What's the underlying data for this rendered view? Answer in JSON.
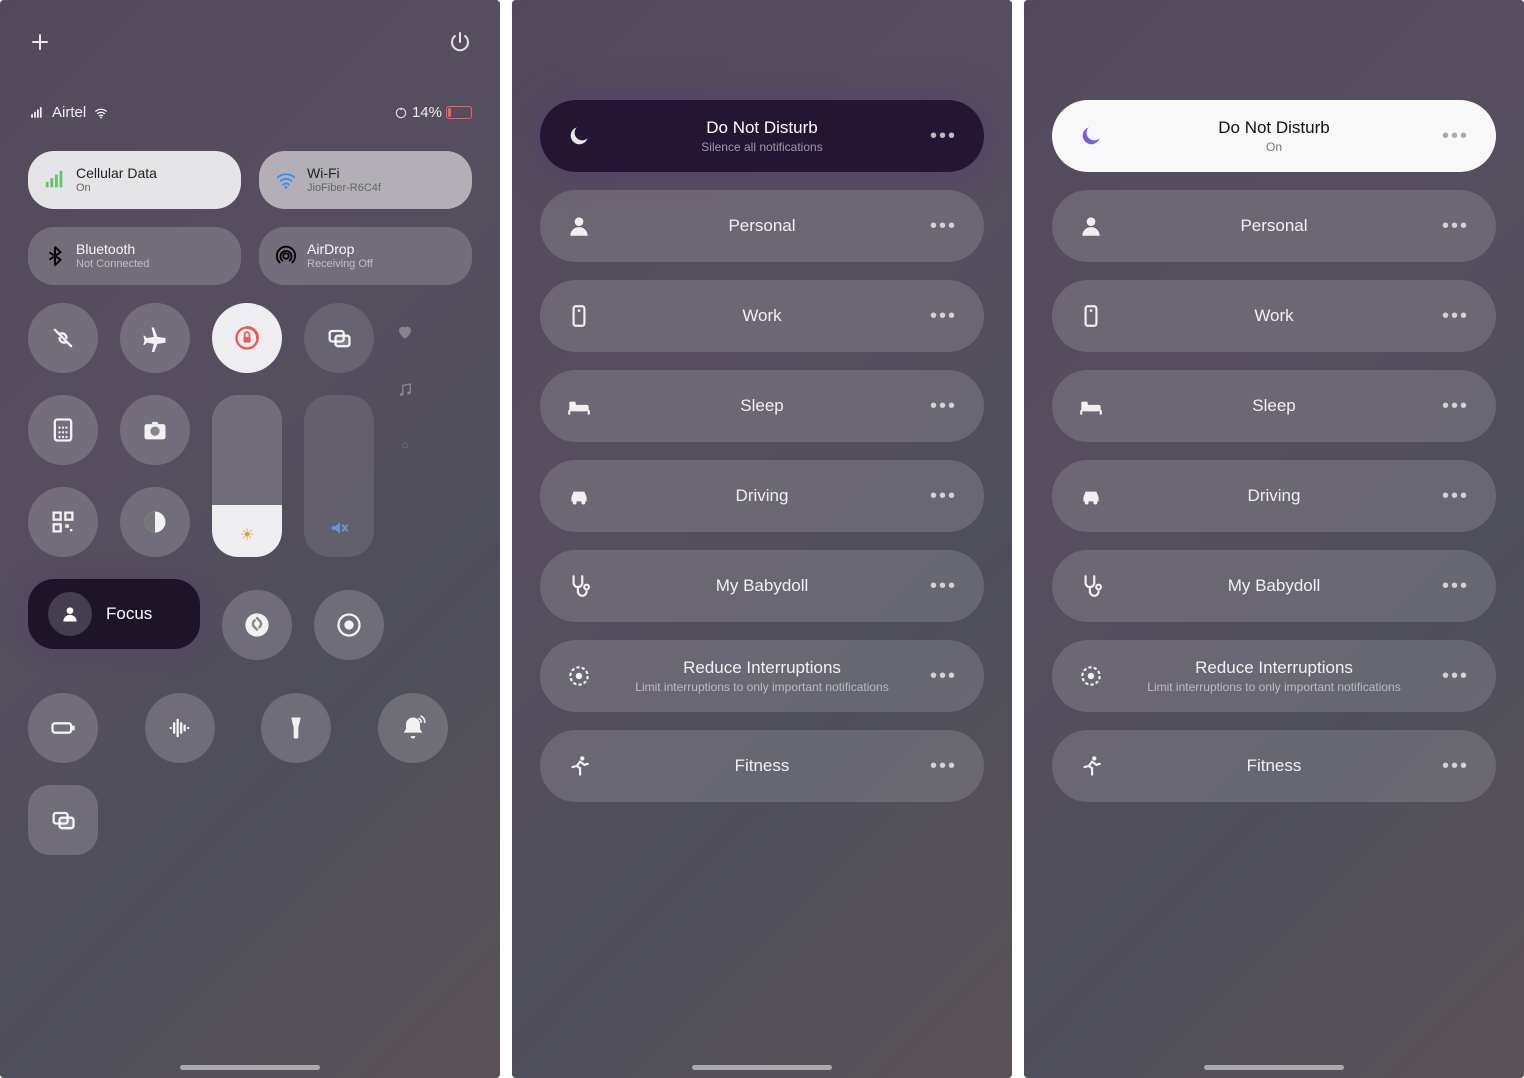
{
  "panels": {
    "controlCenter": {
      "status": {
        "carrier": "Airtel",
        "batteryPct": "14%"
      },
      "tiles": {
        "cellular": {
          "title": "Cellular Data",
          "sub": "On"
        },
        "wifi": {
          "title": "Wi-Fi",
          "sub": "JioFiber-R6C4f"
        },
        "bluetooth": {
          "title": "Bluetooth",
          "sub": "Not Connected"
        },
        "airdrop": {
          "title": "AirDrop",
          "sub": "Receiving Off"
        }
      },
      "focusPill": {
        "label": "Focus"
      }
    },
    "focusMenu": {
      "dnd": {
        "title": "Do Not Disturb",
        "sub": "Silence all notifications"
      },
      "items": [
        {
          "icon": "person",
          "title": "Personal"
        },
        {
          "icon": "work",
          "title": "Work"
        },
        {
          "icon": "sleep",
          "title": "Sleep"
        },
        {
          "icon": "driving",
          "title": "Driving"
        },
        {
          "icon": "stethoscope",
          "title": "My Babydoll"
        },
        {
          "icon": "reduce",
          "title": "Reduce Interruptions",
          "sub": "Limit interruptions to only important notifications"
        },
        {
          "icon": "fitness",
          "title": "Fitness"
        }
      ]
    },
    "focusMenuActive": {
      "dnd": {
        "title": "Do Not Disturb",
        "sub": "On"
      },
      "items": [
        {
          "icon": "person",
          "title": "Personal"
        },
        {
          "icon": "work",
          "title": "Work"
        },
        {
          "icon": "sleep",
          "title": "Sleep"
        },
        {
          "icon": "driving",
          "title": "Driving"
        },
        {
          "icon": "stethoscope",
          "title": "My Babydoll"
        },
        {
          "icon": "reduce",
          "title": "Reduce Interruptions",
          "sub": "Limit interruptions to only important notifications"
        },
        {
          "icon": "fitness",
          "title": "Fitness"
        }
      ]
    }
  }
}
